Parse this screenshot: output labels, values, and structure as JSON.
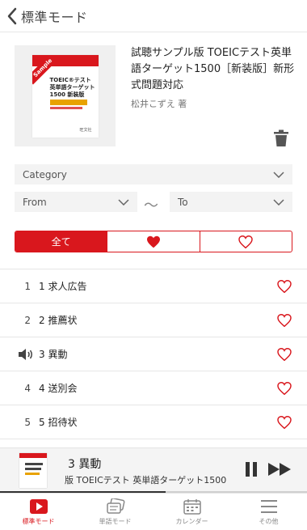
{
  "header": {
    "back_label": "標準モード"
  },
  "book": {
    "title": "試聴サンプル版 TOEICテスト英単語ターゲット1500［新装版］新形式問題対応",
    "author": "松井こずえ 著",
    "cover": {
      "sample": "Sample",
      "line1": "TOEIC®テスト",
      "line2": "英単語ターゲット",
      "line3": "1500 新装版",
      "publisher": "旺文社"
    }
  },
  "filters": {
    "category_placeholder": "Category",
    "from_placeholder": "From",
    "to_placeholder": "To",
    "tilde": "〜"
  },
  "segments": {
    "all": "全て"
  },
  "list": [
    {
      "num": "1",
      "label": "1 求人広告",
      "playing": false
    },
    {
      "num": "2",
      "label": "2 推薦状",
      "playing": false
    },
    {
      "num": "",
      "label": "3 異動",
      "playing": true
    },
    {
      "num": "4",
      "label": "4 送別会",
      "playing": false
    },
    {
      "num": "5",
      "label": "5 招待状",
      "playing": false
    }
  ],
  "player": {
    "title": "3 異動",
    "subtitle": "版 TOEICテスト 英単語ターゲット1500",
    "progress_fraction": 0.54
  },
  "tabs": [
    {
      "label": "標準モード",
      "icon": "play-icon",
      "active": true
    },
    {
      "label": "単語モード",
      "icon": "cards-icon",
      "active": false
    },
    {
      "label": "カレンダー",
      "icon": "calendar-icon",
      "active": false
    },
    {
      "label": "その他",
      "icon": "menu-icon",
      "active": false
    }
  ],
  "colors": {
    "accent": "#d9171d"
  }
}
